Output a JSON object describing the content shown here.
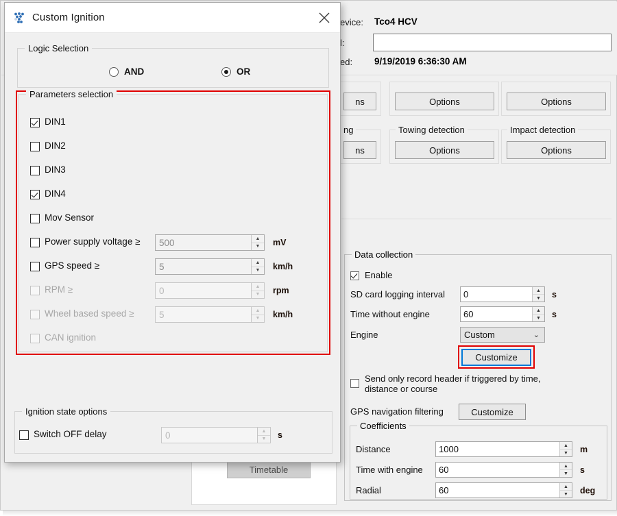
{
  "background_window": {
    "header": {
      "device_label": "evice:",
      "device_value": "Tco4 HCV",
      "id_label": "l:",
      "id_value": "",
      "updated_label": "ed:",
      "updated_value": "9/19/2019 6:36:30 AM"
    },
    "groups_row1": [
      {
        "title": "",
        "button": "ns"
      },
      {
        "title": "",
        "button": "Options"
      },
      {
        "title": "",
        "button": "Options"
      }
    ],
    "groups_row2": [
      {
        "title": "ng",
        "button": "ns"
      },
      {
        "title": "Towing detection",
        "button": "Options"
      },
      {
        "title": "Impact detection",
        "button": "Options"
      }
    ],
    "timetable_button": "Timetable",
    "data_collection": {
      "title": "Data collection",
      "enable_label": "Enable",
      "enable_checked": true,
      "rows": [
        {
          "label": "SD card logging interval",
          "value": "0",
          "unit": "s"
        },
        {
          "label": "Time without engine",
          "value": "60",
          "unit": "s"
        }
      ],
      "engine_label": "Engine",
      "engine_value": "Custom",
      "customize_button": "Customize",
      "send_only_header_label_line1": "Send only record header if triggered by time,",
      "send_only_header_label_line2": "distance or course",
      "send_only_header_checked": false,
      "gps_filtering_label": "GPS navigation filtering",
      "gps_filtering_button": "Customize",
      "coefficients": {
        "title": "Coefficients",
        "rows": [
          {
            "label": "Distance",
            "value": "1000",
            "unit": "m"
          },
          {
            "label": "Time with engine",
            "value": "60",
            "unit": "s"
          },
          {
            "label": "Radial",
            "value": "60",
            "unit": "deg"
          }
        ]
      }
    }
  },
  "dialog": {
    "title": "Custom Ignition",
    "icon": "app-dots-icon",
    "close_icon": "close-icon",
    "logic_selection": {
      "title": "Logic Selection",
      "options": [
        {
          "label": "AND",
          "selected": false
        },
        {
          "label": "OR",
          "selected": true
        }
      ]
    },
    "parameters_selection": {
      "title": "Parameters selection",
      "highlight_color": "#e00000",
      "items": [
        {
          "label": "DIN1",
          "checked": true,
          "disabled": false,
          "has_spin": false
        },
        {
          "label": "DIN2",
          "checked": false,
          "disabled": false,
          "has_spin": false
        },
        {
          "label": "DIN3",
          "checked": false,
          "disabled": false,
          "has_spin": false
        },
        {
          "label": "DIN4",
          "checked": true,
          "disabled": false,
          "has_spin": false
        },
        {
          "label": "Mov Sensor",
          "checked": false,
          "disabled": false,
          "has_spin": false
        },
        {
          "label": "Power supply voltage ≥",
          "checked": false,
          "disabled": false,
          "has_spin": true,
          "value": "500",
          "unit": "mV"
        },
        {
          "label": "GPS speed ≥",
          "checked": false,
          "disabled": false,
          "has_spin": true,
          "value": "5",
          "unit": "km/h"
        },
        {
          "label": "RPM ≥",
          "checked": false,
          "disabled": true,
          "has_spin": true,
          "value": "0",
          "unit": "rpm"
        },
        {
          "label": "Wheel based speed ≥",
          "checked": false,
          "disabled": true,
          "has_spin": true,
          "value": "5",
          "unit": "km/h"
        },
        {
          "label": "CAN ignition",
          "checked": false,
          "disabled": true,
          "has_spin": false
        }
      ]
    },
    "ignition_state_options": {
      "title": "Ignition state options",
      "switch_off_delay_label": "Switch OFF delay",
      "switch_off_delay_checked": false,
      "switch_off_delay_value": "0",
      "switch_off_delay_unit": "s"
    }
  }
}
